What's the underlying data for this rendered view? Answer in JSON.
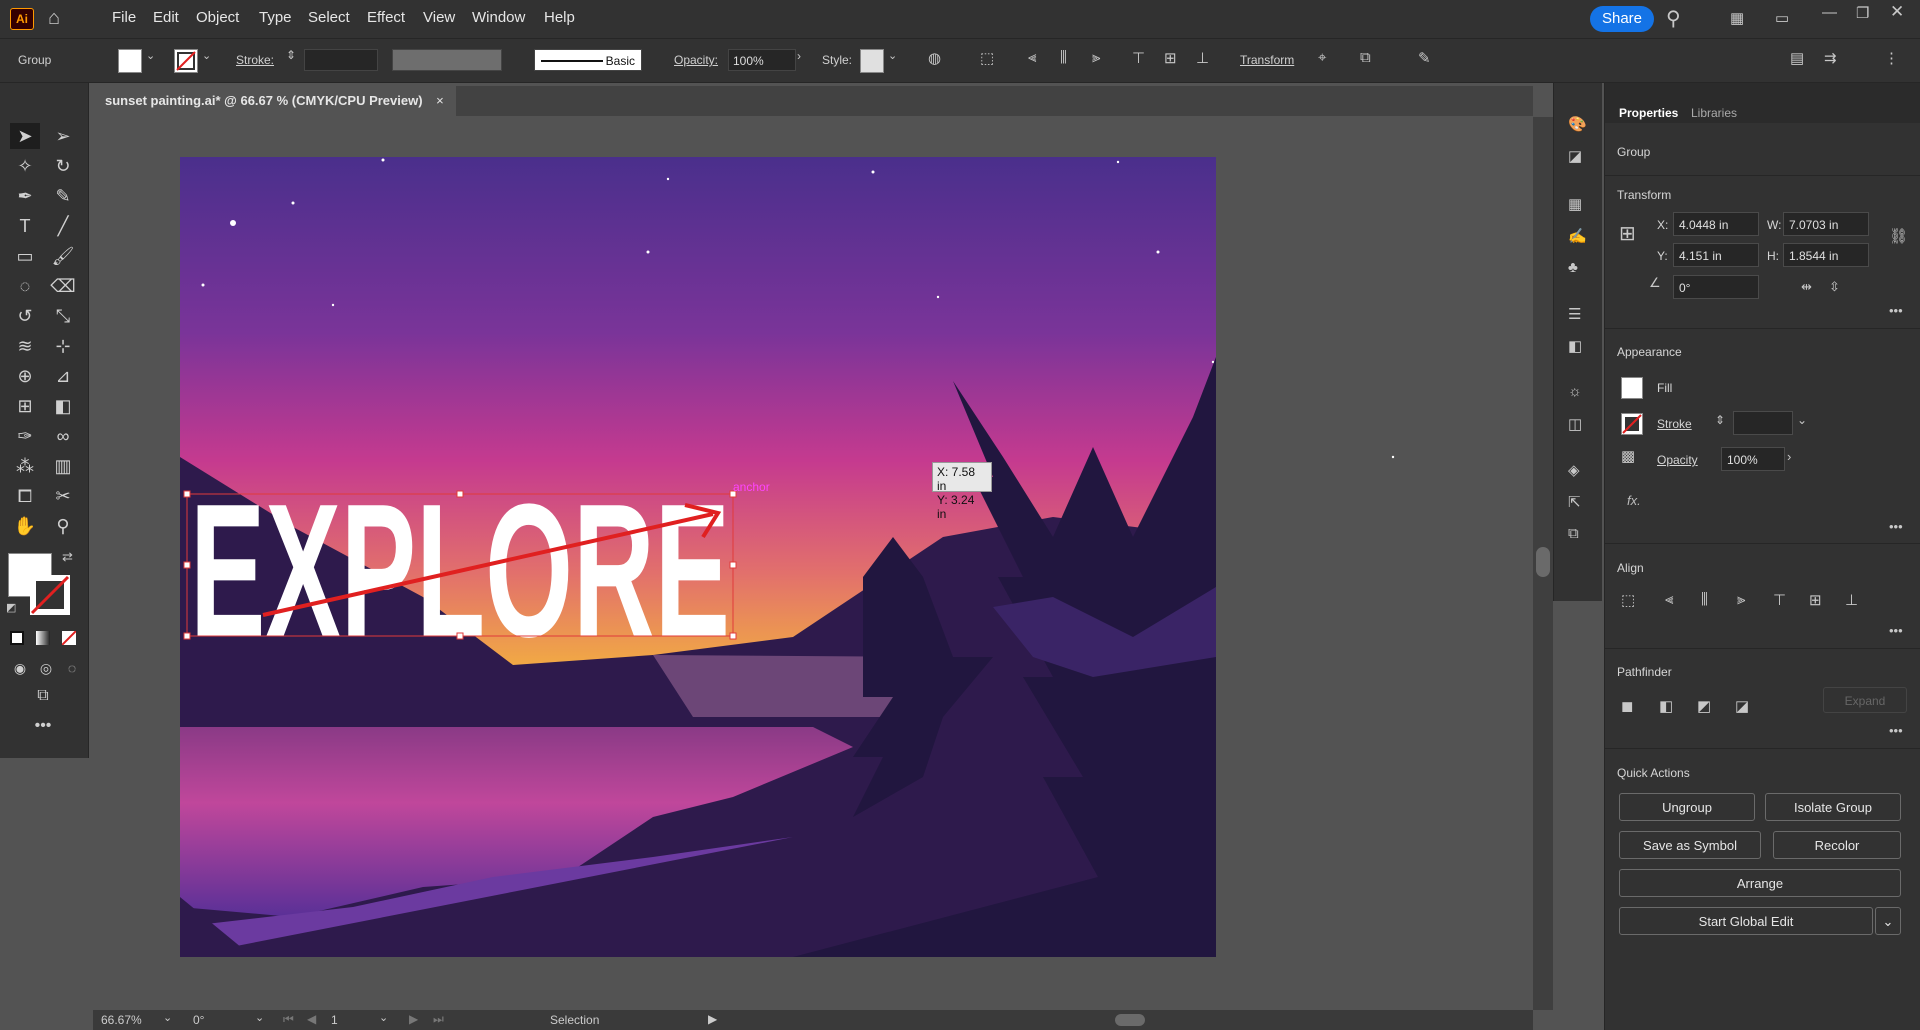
{
  "app": {
    "logo": "Ai",
    "share_label": "Share"
  },
  "menu": [
    "File",
    "Edit",
    "Object",
    "Type",
    "Select",
    "Effect",
    "View",
    "Window",
    "Help"
  ],
  "control_bar": {
    "selection_type": "Group",
    "stroke_label": "Stroke:",
    "brush_label": "Basic",
    "opacity_label": "Opacity:",
    "opacity_value": "100%",
    "style_label": "Style:",
    "transform_label": "Transform"
  },
  "document": {
    "tab_title": "sunset painting.ai* @ 66.67 % (CMYK/CPU Preview)",
    "close_glyph": "×",
    "artwork_text": "EXPLORE",
    "smart_guide_label": "anchor",
    "cursor_tooltip": {
      "x": "X: 7.58 in",
      "y": "Y: 3.24 in"
    },
    "colors": {
      "sky_top": "#4a2f8c",
      "sky_mid": "#c53a8f",
      "horizon": "#f4b53c",
      "mountain": "#2e1a4c",
      "tree": "#21163f",
      "water": "#c0479b",
      "arrow": "#e02020",
      "selection": "#e03a3a"
    }
  },
  "status_bar": {
    "zoom": "66.67%",
    "rotation": "0°",
    "artboard": "1",
    "tool": "Selection"
  },
  "properties": {
    "tabs": [
      "Properties",
      "Libraries"
    ],
    "selection_type": "Group",
    "transform": {
      "title": "Transform",
      "x_label": "X:",
      "x_value": "4.0448 in",
      "y_label": "Y:",
      "y_value": "4.151 in",
      "w_label": "W:",
      "w_value": "7.0703 in",
      "h_label": "H:",
      "h_value": "1.8544 in",
      "angle_value": "0°"
    },
    "appearance": {
      "title": "Appearance",
      "fill_label": "Fill",
      "stroke_label": "Stroke",
      "opacity_label": "Opacity",
      "opacity_value": "100%",
      "fx_label": "fx."
    },
    "align_title": "Align",
    "pathfinder": {
      "title": "Pathfinder",
      "expand_label": "Expand"
    },
    "quick_actions": {
      "title": "Quick Actions",
      "ungroup": "Ungroup",
      "isolate_group": "Isolate Group",
      "save_as_symbol": "Save as Symbol",
      "recolor": "Recolor",
      "arrange": "Arrange",
      "start_global_edit": "Start Global Edit"
    }
  }
}
